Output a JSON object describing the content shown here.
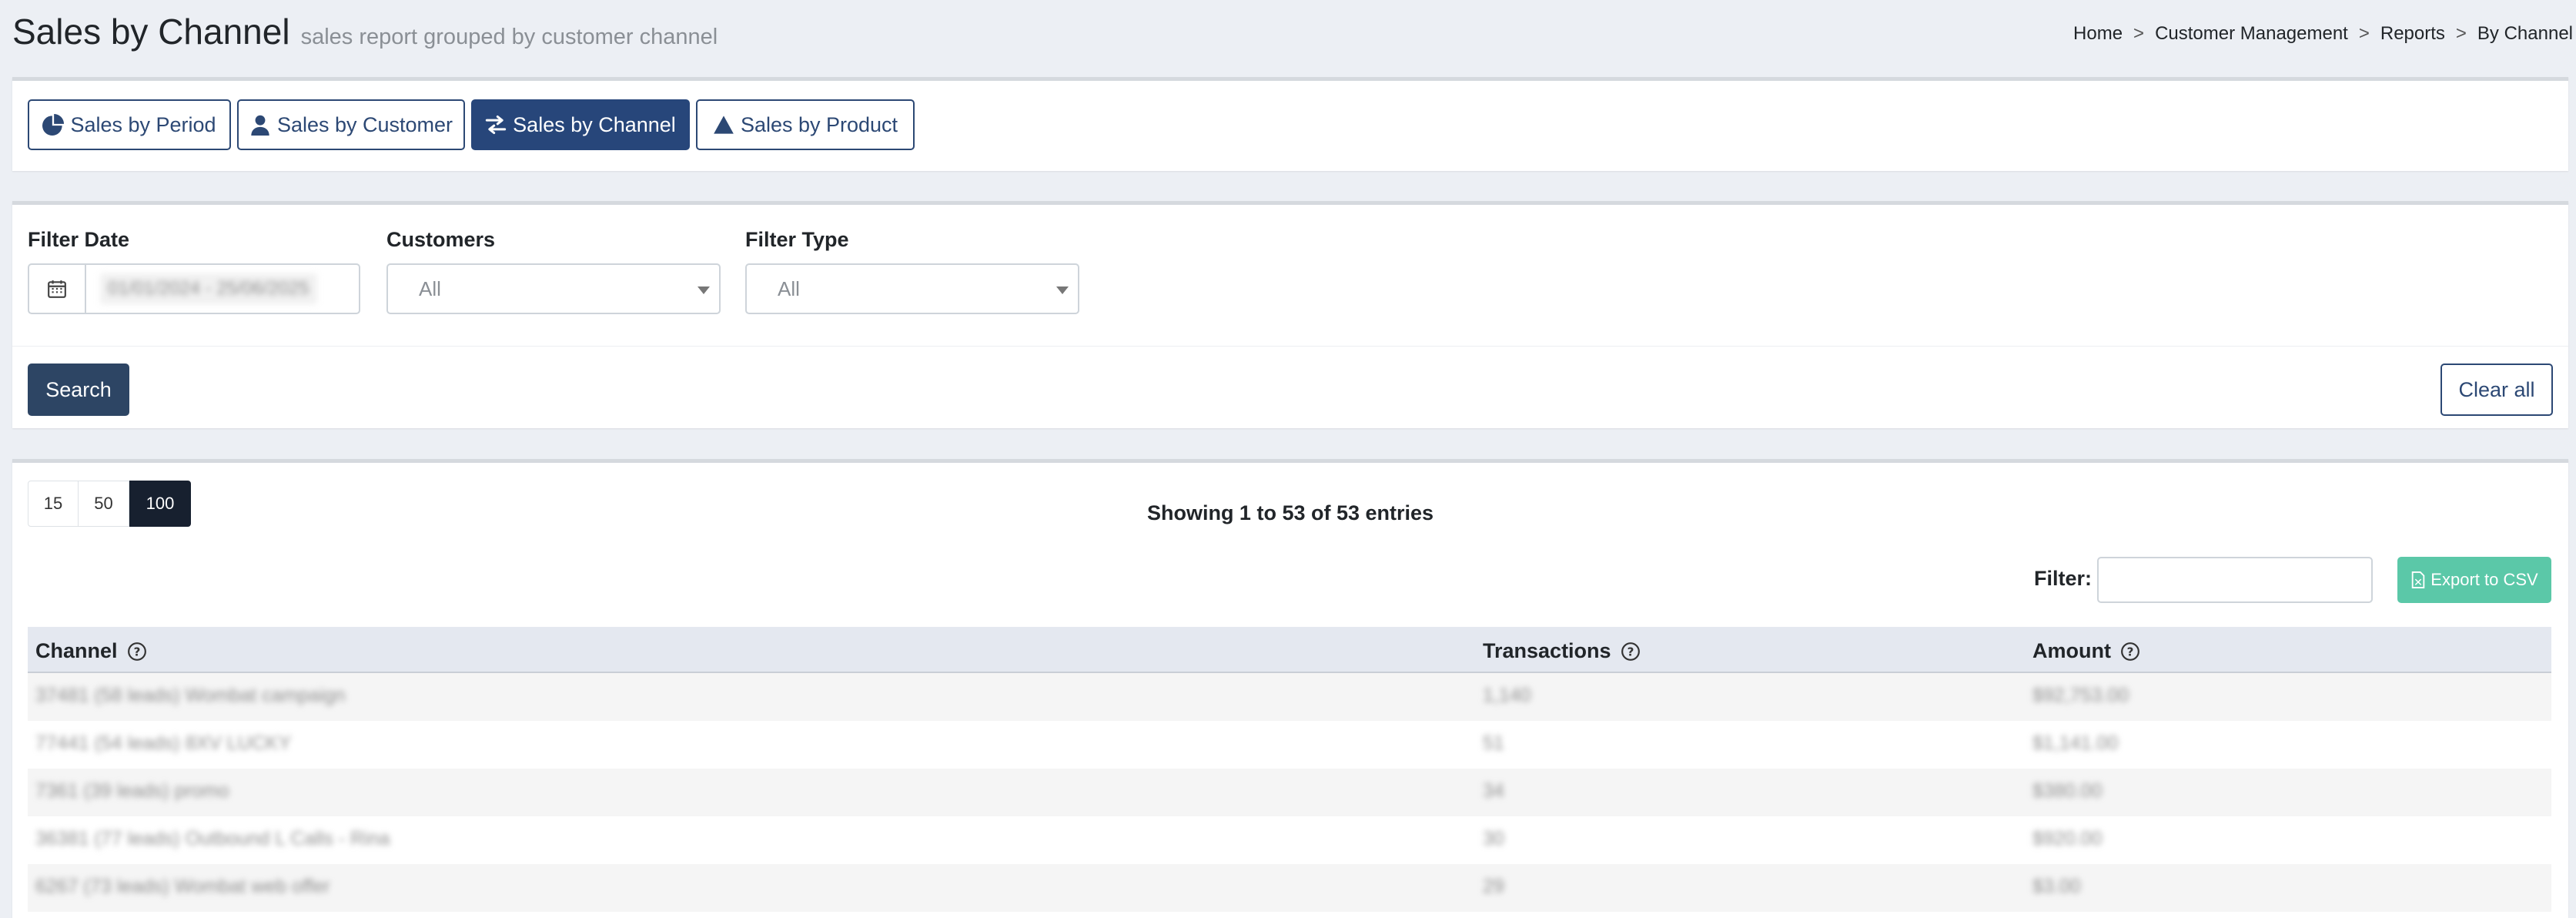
{
  "header": {
    "title": "Sales by Channel",
    "subtitle": "sales report grouped by customer channel",
    "breadcrumb": [
      "Home",
      "Customer Management",
      "Reports",
      "By Channel"
    ]
  },
  "tabs": [
    {
      "label": "Sales by Period",
      "icon": "pie-chart-icon",
      "active": false
    },
    {
      "label": "Sales by Customer",
      "icon": "user-icon",
      "active": false
    },
    {
      "label": "Sales by Channel",
      "icon": "exchange-arrows-icon",
      "active": true
    },
    {
      "label": "Sales by Product",
      "icon": "triangle-icon",
      "active": false
    }
  ],
  "filters": {
    "date_label": "Filter Date",
    "date_value": "01/01/2024 - 25/06/2025",
    "customers_label": "Customers",
    "customers_value": "All",
    "type_label": "Filter Type",
    "type_value": "All",
    "search_label": "Search",
    "clear_label": "Clear all"
  },
  "table_controls": {
    "page_sizes": [
      "15",
      "50",
      "100"
    ],
    "selected_page_size": "100",
    "showing": "Showing 1 to 53 of 53 entries",
    "filter_label": "Filter:",
    "filter_value": "",
    "export_label": "Export to CSV"
  },
  "table": {
    "columns": [
      "Channel",
      "Transactions",
      "Amount"
    ],
    "rows": [
      [
        "37481 (58 leads) Wombat campaign",
        "1,140",
        "$92,753.00"
      ],
      [
        "77441 (54 leads) 8XV LUCKY",
        "51",
        "$1,141.00"
      ],
      [
        "7361 (39 leads) promo",
        "34",
        "$380.00"
      ],
      [
        "36381 (77 leads) Outbound L Calls - Rina",
        "30",
        "$920.00"
      ],
      [
        "6267 (73 leads) Wombat web offer",
        "29",
        "$3.00"
      ]
    ]
  },
  "colors": {
    "primary": "#27467a",
    "search_button": "#2d4564",
    "export_button": "#5bc8a8",
    "background": "#eceff4"
  }
}
